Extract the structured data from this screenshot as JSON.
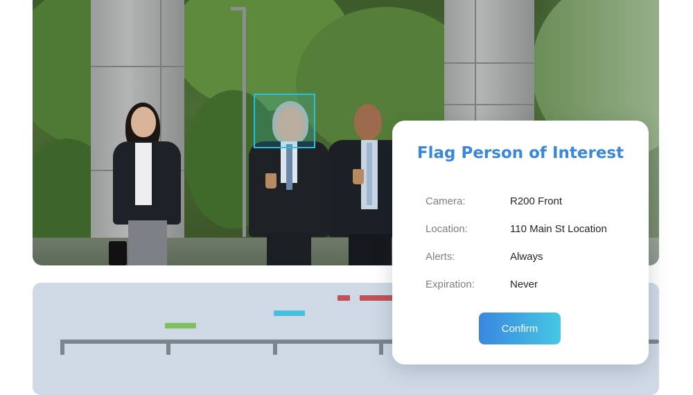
{
  "dialog": {
    "title": "Flag Person of Interest",
    "details": [
      {
        "label": "Camera:",
        "value": "R200 Front"
      },
      {
        "label": "Location:",
        "value": "110 Main St Location"
      },
      {
        "label": "Alerts:",
        "value": "Always"
      },
      {
        "label": "Expiration:",
        "value": "Never"
      }
    ],
    "confirm_label": "Confirm"
  },
  "colors": {
    "accent_blue": "#3a86d8",
    "detection_box": "#27c0e0",
    "timeline_bg": "#ced9e5",
    "event_green": "#7fbf5f",
    "event_cyan": "#46c0dc",
    "event_red": "#c0505a"
  },
  "timeline": {
    "event_colors": [
      "green",
      "cyan",
      "red",
      "red"
    ]
  }
}
